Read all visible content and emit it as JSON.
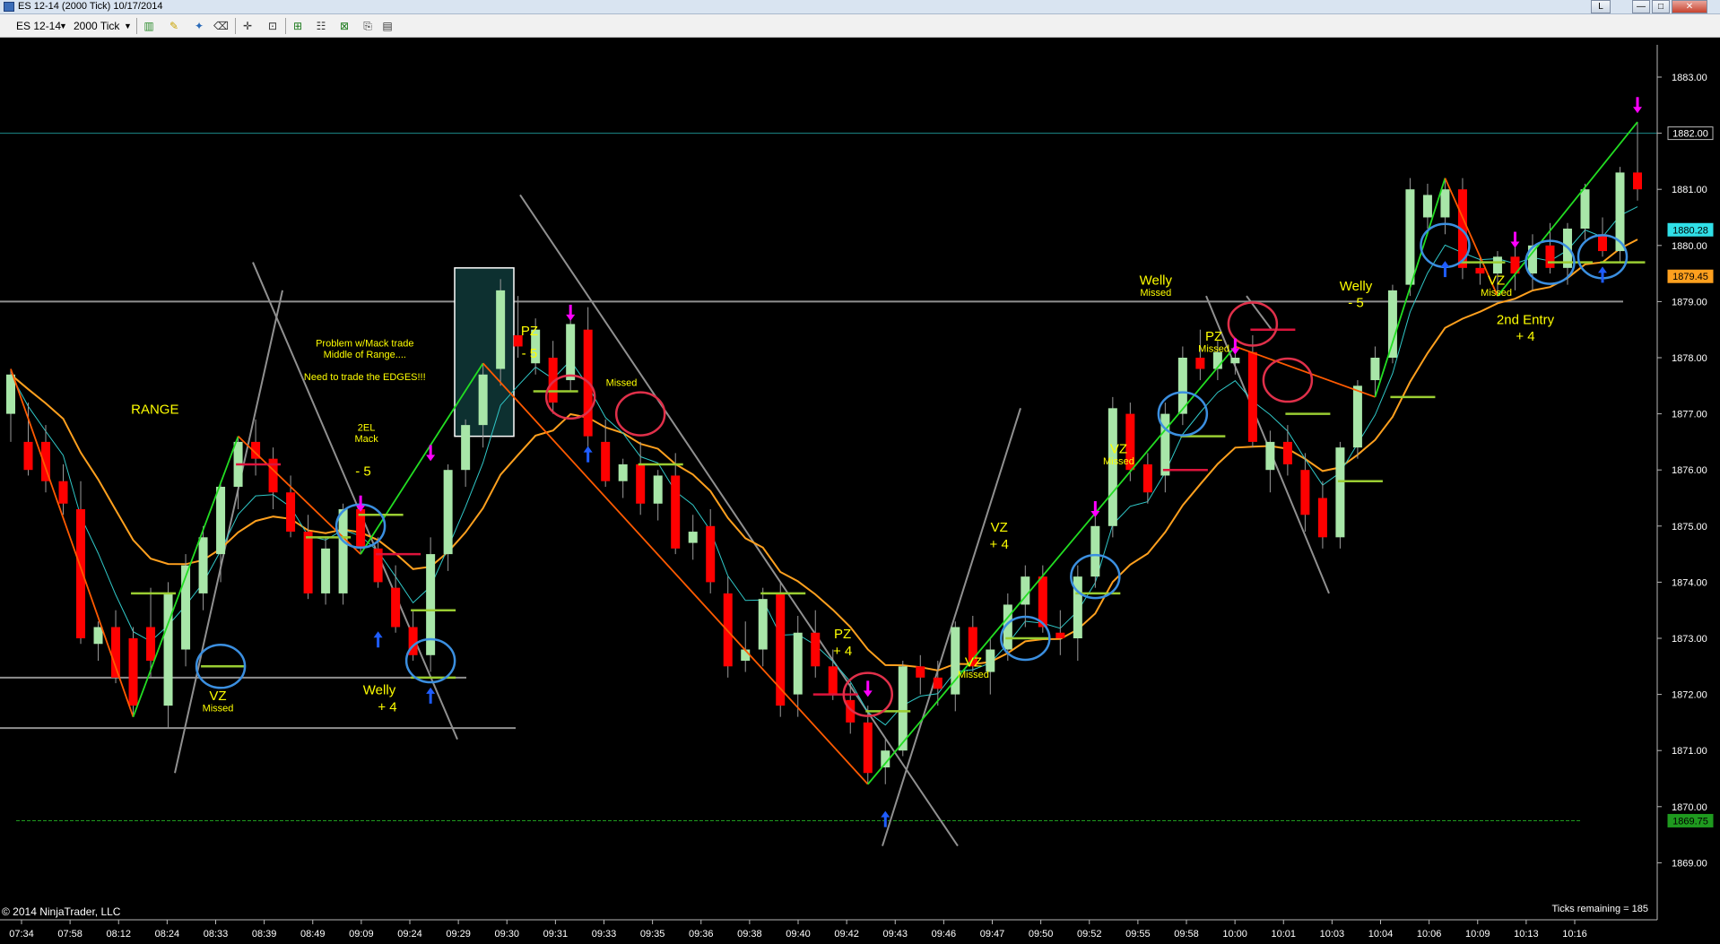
{
  "window": {
    "title": "ES 12-14 (2000 Tick)  10/17/2014",
    "minimize_label": "L",
    "restore_label": "—",
    "maximize_label": "□",
    "close_label": "✕"
  },
  "toolbar": {
    "instrument": "ES 12-14",
    "interval": "2000 Tick",
    "icons": [
      "bar-type-icon",
      "pencil-draw-icon",
      "magic-wand-icon",
      "eraser-icon",
      "crosshair-icon",
      "zoom-icon",
      "order-icon",
      "properties-icon",
      "indicators-icon",
      "strategies-icon"
    ]
  },
  "footer": {
    "copyright": "© 2014 NinjaTrader, LLC",
    "ticks_remaining": "Ticks remaining = 185"
  },
  "colors": {
    "background": "#000000",
    "up_candle": "#a8e6a8",
    "down_candle": "#ff0000",
    "zigzag_green": "#22dd22",
    "zigzag_orange": "#ff5a00",
    "ma_slow": "#ffa01e",
    "ma_fast": "#30c8c8",
    "trend_lines": "#909090",
    "annotation_text": "#ffff00",
    "circle_blue": "#3b8fe0",
    "circle_red": "#e0304a",
    "arrow_magenta": "#ff00ff",
    "arrow_blue": "#1e5cff",
    "level_green": "#9acd32",
    "level_red": "#dc143c"
  },
  "chart_data": {
    "type": "candlestick",
    "instrument": "ES 12-14",
    "interval": "2000 Tick",
    "date": "10/17/2014",
    "yticks": [
      "1869.00",
      "1870.00",
      "1871.00",
      "1872.00",
      "1873.00",
      "1874.00",
      "1875.00",
      "1876.00",
      "1877.00",
      "1878.00",
      "1879.00",
      "1880.00",
      "1881.00",
      "1882.00",
      "1883.00"
    ],
    "ylim": [
      1868.2,
      1883.9
    ],
    "xticks": [
      "07:34",
      "07:58",
      "08:12",
      "08:24",
      "08:33",
      "08:39",
      "08:49",
      "09:09",
      "09:24",
      "09:29",
      "09:30",
      "09:31",
      "09:33",
      "09:35",
      "09:36",
      "09:38",
      "09:40",
      "09:42",
      "09:43",
      "09:46",
      "09:47",
      "09:50",
      "09:52",
      "09:55",
      "09:58",
      "10:00",
      "10:01",
      "10:03",
      "10:04",
      "10:06",
      "10:09",
      "10:13",
      "10:16"
    ],
    "price_markers": [
      {
        "label": "1882.00",
        "value": 1882.0,
        "kind": "horizontal-line"
      },
      {
        "label": "1880.28",
        "value": 1880.28,
        "kind": "fast-ma"
      },
      {
        "label": "1879.45",
        "value": 1879.45,
        "kind": "slow-ma"
      },
      {
        "label": "1869.75",
        "value": 1869.75,
        "kind": "horizontal-line"
      }
    ],
    "candles": [
      {
        "o": 1877.0,
        "h": 1877.8,
        "l": 1876.5,
        "c": 1877.7
      },
      {
        "o": 1876.5,
        "h": 1877.2,
        "l": 1875.9,
        "c": 1876.0
      },
      {
        "o": 1876.5,
        "h": 1876.8,
        "l": 1875.6,
        "c": 1875.8
      },
      {
        "o": 1875.8,
        "h": 1876.1,
        "l": 1875.2,
        "c": 1875.4
      },
      {
        "o": 1875.3,
        "h": 1875.8,
        "l": 1872.9,
        "c": 1873.0
      },
      {
        "o": 1872.9,
        "h": 1873.3,
        "l": 1872.6,
        "c": 1873.2
      },
      {
        "o": 1873.2,
        "h": 1873.5,
        "l": 1872.2,
        "c": 1872.3
      },
      {
        "o": 1873.0,
        "h": 1873.2,
        "l": 1871.6,
        "c": 1871.8
      },
      {
        "o": 1873.2,
        "h": 1873.9,
        "l": 1872.3,
        "c": 1872.6
      },
      {
        "o": 1871.8,
        "h": 1874.0,
        "l": 1871.4,
        "c": 1873.8
      },
      {
        "o": 1872.8,
        "h": 1874.5,
        "l": 1872.5,
        "c": 1874.3
      },
      {
        "o": 1873.8,
        "h": 1875.0,
        "l": 1873.5,
        "c": 1874.8
      },
      {
        "o": 1874.5,
        "h": 1875.8,
        "l": 1874.0,
        "c": 1875.7
      },
      {
        "o": 1875.7,
        "h": 1876.6,
        "l": 1875.3,
        "c": 1876.5
      },
      {
        "o": 1876.5,
        "h": 1876.9,
        "l": 1875.9,
        "c": 1876.2
      },
      {
        "o": 1876.2,
        "h": 1876.4,
        "l": 1875.3,
        "c": 1875.6
      },
      {
        "o": 1875.6,
        "h": 1875.9,
        "l": 1874.8,
        "c": 1874.9
      },
      {
        "o": 1874.9,
        "h": 1875.2,
        "l": 1873.7,
        "c": 1873.8
      },
      {
        "o": 1873.8,
        "h": 1874.8,
        "l": 1873.6,
        "c": 1874.6
      },
      {
        "o": 1873.8,
        "h": 1875.4,
        "l": 1873.6,
        "c": 1875.3
      },
      {
        "o": 1875.3,
        "h": 1875.5,
        "l": 1874.5,
        "c": 1874.6
      },
      {
        "o": 1874.6,
        "h": 1874.8,
        "l": 1873.9,
        "c": 1874.0
      },
      {
        "o": 1873.9,
        "h": 1874.3,
        "l": 1873.1,
        "c": 1873.2
      },
      {
        "o": 1873.2,
        "h": 1873.5,
        "l": 1872.6,
        "c": 1872.7
      },
      {
        "o": 1872.7,
        "h": 1874.8,
        "l": 1872.4,
        "c": 1874.5
      },
      {
        "o": 1874.5,
        "h": 1876.1,
        "l": 1874.2,
        "c": 1876.0
      },
      {
        "o": 1876.0,
        "h": 1876.9,
        "l": 1875.7,
        "c": 1876.8
      },
      {
        "o": 1876.8,
        "h": 1877.9,
        "l": 1876.4,
        "c": 1877.7
      },
      {
        "o": 1877.8,
        "h": 1879.4,
        "l": 1877.5,
        "c": 1879.2
      },
      {
        "o": 1878.4,
        "h": 1879.1,
        "l": 1878.0,
        "c": 1878.2
      },
      {
        "o": 1877.9,
        "h": 1878.7,
        "l": 1877.7,
        "c": 1878.5
      },
      {
        "o": 1878.0,
        "h": 1878.3,
        "l": 1877.0,
        "c": 1877.2
      },
      {
        "o": 1877.6,
        "h": 1878.8,
        "l": 1877.4,
        "c": 1878.6
      },
      {
        "o": 1878.5,
        "h": 1878.9,
        "l": 1876.4,
        "c": 1876.6
      },
      {
        "o": 1876.5,
        "h": 1876.9,
        "l": 1875.7,
        "c": 1875.8
      },
      {
        "o": 1875.8,
        "h": 1876.2,
        "l": 1875.5,
        "c": 1876.1
      },
      {
        "o": 1876.1,
        "h": 1876.5,
        "l": 1875.2,
        "c": 1875.4
      },
      {
        "o": 1875.4,
        "h": 1876.0,
        "l": 1875.1,
        "c": 1875.9
      },
      {
        "o": 1875.9,
        "h": 1876.3,
        "l": 1874.5,
        "c": 1874.6
      },
      {
        "o": 1874.7,
        "h": 1875.2,
        "l": 1874.4,
        "c": 1874.9
      },
      {
        "o": 1875.0,
        "h": 1875.3,
        "l": 1873.8,
        "c": 1874.0
      },
      {
        "o": 1873.8,
        "h": 1874.1,
        "l": 1872.3,
        "c": 1872.5
      },
      {
        "o": 1872.6,
        "h": 1873.3,
        "l": 1872.4,
        "c": 1872.8
      },
      {
        "o": 1872.8,
        "h": 1873.9,
        "l": 1872.5,
        "c": 1873.7
      },
      {
        "o": 1873.8,
        "h": 1874.0,
        "l": 1871.6,
        "c": 1871.8
      },
      {
        "o": 1872.0,
        "h": 1873.4,
        "l": 1871.6,
        "c": 1873.1
      },
      {
        "o": 1873.1,
        "h": 1873.5,
        "l": 1872.3,
        "c": 1872.5
      },
      {
        "o": 1872.5,
        "h": 1872.8,
        "l": 1871.9,
        "c": 1872.0
      },
      {
        "o": 1871.9,
        "h": 1872.2,
        "l": 1871.3,
        "c": 1871.5
      },
      {
        "o": 1871.5,
        "h": 1871.8,
        "l": 1870.4,
        "c": 1870.6
      },
      {
        "o": 1870.7,
        "h": 1871.2,
        "l": 1870.4,
        "c": 1871.0
      },
      {
        "o": 1871.0,
        "h": 1872.6,
        "l": 1870.9,
        "c": 1872.5
      },
      {
        "o": 1872.5,
        "h": 1872.7,
        "l": 1872.0,
        "c": 1872.3
      },
      {
        "o": 1872.3,
        "h": 1872.6,
        "l": 1871.8,
        "c": 1872.1
      },
      {
        "o": 1872.0,
        "h": 1873.3,
        "l": 1871.7,
        "c": 1873.2
      },
      {
        "o": 1873.2,
        "h": 1873.4,
        "l": 1872.4,
        "c": 1872.5
      },
      {
        "o": 1872.4,
        "h": 1873.0,
        "l": 1872.0,
        "c": 1872.8
      },
      {
        "o": 1872.8,
        "h": 1873.8,
        "l": 1872.6,
        "c": 1873.6
      },
      {
        "o": 1873.6,
        "h": 1874.3,
        "l": 1873.2,
        "c": 1874.1
      },
      {
        "o": 1874.1,
        "h": 1874.3,
        "l": 1873.1,
        "c": 1873.2
      },
      {
        "o": 1873.1,
        "h": 1873.5,
        "l": 1872.7,
        "c": 1873.0
      },
      {
        "o": 1873.0,
        "h": 1874.3,
        "l": 1872.6,
        "c": 1874.1
      },
      {
        "o": 1874.1,
        "h": 1875.2,
        "l": 1873.9,
        "c": 1875.0
      },
      {
        "o": 1875.0,
        "h": 1877.3,
        "l": 1874.8,
        "c": 1877.1
      },
      {
        "o": 1877.0,
        "h": 1877.2,
        "l": 1875.8,
        "c": 1876.0
      },
      {
        "o": 1876.1,
        "h": 1876.3,
        "l": 1875.4,
        "c": 1875.6
      },
      {
        "o": 1875.9,
        "h": 1877.2,
        "l": 1875.6,
        "c": 1877.0
      },
      {
        "o": 1877.0,
        "h": 1878.2,
        "l": 1876.8,
        "c": 1878.0
      },
      {
        "o": 1878.0,
        "h": 1878.5,
        "l": 1877.6,
        "c": 1877.8
      },
      {
        "o": 1877.8,
        "h": 1878.3,
        "l": 1877.6,
        "c": 1878.1
      },
      {
        "o": 1877.9,
        "h": 1878.2,
        "l": 1877.7,
        "c": 1878.0
      },
      {
        "o": 1878.1,
        "h": 1878.4,
        "l": 1876.4,
        "c": 1876.5
      },
      {
        "o": 1876.0,
        "h": 1876.7,
        "l": 1875.6,
        "c": 1876.5
      },
      {
        "o": 1876.5,
        "h": 1876.8,
        "l": 1875.9,
        "c": 1876.1
      },
      {
        "o": 1876.0,
        "h": 1876.3,
        "l": 1874.9,
        "c": 1875.2
      },
      {
        "o": 1875.5,
        "h": 1875.8,
        "l": 1874.6,
        "c": 1874.8
      },
      {
        "o": 1874.8,
        "h": 1876.5,
        "l": 1874.6,
        "c": 1876.4
      },
      {
        "o": 1876.4,
        "h": 1877.6,
        "l": 1876.2,
        "c": 1877.5
      },
      {
        "o": 1877.6,
        "h": 1878.2,
        "l": 1877.3,
        "c": 1878.0
      },
      {
        "o": 1878.0,
        "h": 1879.3,
        "l": 1877.9,
        "c": 1879.2
      },
      {
        "o": 1879.3,
        "h": 1881.2,
        "l": 1879.1,
        "c": 1881.0
      },
      {
        "o": 1880.5,
        "h": 1881.1,
        "l": 1880.3,
        "c": 1880.9
      },
      {
        "o": 1880.5,
        "h": 1881.2,
        "l": 1880.2,
        "c": 1881.0
      },
      {
        "o": 1881.0,
        "h": 1881.2,
        "l": 1879.4,
        "c": 1879.6
      },
      {
        "o": 1879.6,
        "h": 1879.8,
        "l": 1879.3,
        "c": 1879.5
      },
      {
        "o": 1879.5,
        "h": 1879.9,
        "l": 1879.1,
        "c": 1879.8
      },
      {
        "o": 1879.8,
        "h": 1880.1,
        "l": 1879.2,
        "c": 1879.5
      },
      {
        "o": 1879.5,
        "h": 1880.2,
        "l": 1879.2,
        "c": 1880.0
      },
      {
        "o": 1880.0,
        "h": 1880.4,
        "l": 1879.5,
        "c": 1879.6
      },
      {
        "o": 1879.6,
        "h": 1880.4,
        "l": 1879.3,
        "c": 1880.3
      },
      {
        "o": 1880.3,
        "h": 1881.1,
        "l": 1880.1,
        "c": 1881.0
      },
      {
        "o": 1880.2,
        "h": 1880.5,
        "l": 1879.8,
        "c": 1879.9
      },
      {
        "o": 1879.9,
        "h": 1881.4,
        "l": 1879.7,
        "c": 1881.3
      },
      {
        "o": 1881.3,
        "h": 1882.2,
        "l": 1880.8,
        "c": 1881.0
      }
    ],
    "annotations": [
      {
        "text": "RANGE",
        "x": 8.6,
        "y": 1877.0
      },
      {
        "text": "Problem w/Mack trade",
        "x": 21.6,
        "y": 1878.2
      },
      {
        "text": "Middle of Range....",
        "x": 21.6,
        "y": 1878.0
      },
      {
        "text": "Need to trade the EDGES!!!",
        "x": 21.6,
        "y": 1877.6
      },
      {
        "text": "2EL",
        "x": 21.7,
        "y": 1876.7
      },
      {
        "text": "Mack",
        "x": 21.7,
        "y": 1876.5
      },
      {
        "text": "- 5",
        "x": 21.5,
        "y": 1875.9
      },
      {
        "text": "VZ",
        "x": 12.5,
        "y": 1871.9
      },
      {
        "text": "Missed",
        "x": 12.5,
        "y": 1871.7
      },
      {
        "text": "Welly",
        "x": 22.5,
        "y": 1872.0
      },
      {
        "text": "+ 4",
        "x": 23.0,
        "y": 1871.7
      },
      {
        "text": "PZ",
        "x": 31.8,
        "y": 1878.4
      },
      {
        "text": "- 5",
        "x": 31.8,
        "y": 1878.0
      },
      {
        "text": "Missed",
        "x": 37.5,
        "y": 1877.5
      },
      {
        "text": "PZ",
        "x": 51.2,
        "y": 1873.0
      },
      {
        "text": "+ 4",
        "x": 51.2,
        "y": 1872.7
      },
      {
        "text": "VZ",
        "x": 60.9,
        "y": 1874.9
      },
      {
        "text": "+ 4",
        "x": 60.9,
        "y": 1874.6
      },
      {
        "text": "VZ",
        "x": 59.3,
        "y": 1872.5
      },
      {
        "text": "Missed",
        "x": 59.3,
        "y": 1872.3
      },
      {
        "text": "VZ",
        "x": 68.3,
        "y": 1876.3
      },
      {
        "text": "Missed",
        "x": 68.3,
        "y": 1876.1
      },
      {
        "text": "Welly",
        "x": 70.6,
        "y": 1879.3
      },
      {
        "text": "Missed",
        "x": 70.6,
        "y": 1879.1
      },
      {
        "text": "PZ",
        "x": 74.2,
        "y": 1878.3
      },
      {
        "text": "Missed",
        "x": 74.2,
        "y": 1878.1
      },
      {
        "text": "Welly",
        "x": 83.0,
        "y": 1879.2
      },
      {
        "text": "- 5",
        "x": 83.0,
        "y": 1878.9
      },
      {
        "text": "VZ",
        "x": 91.7,
        "y": 1879.3
      },
      {
        "text": "Missed",
        "x": 91.7,
        "y": 1879.1
      },
      {
        "text": "2nd Entry",
        "x": 93.5,
        "y": 1878.6
      },
      {
        "text": "+ 4",
        "x": 93.5,
        "y": 1878.3
      }
    ]
  }
}
